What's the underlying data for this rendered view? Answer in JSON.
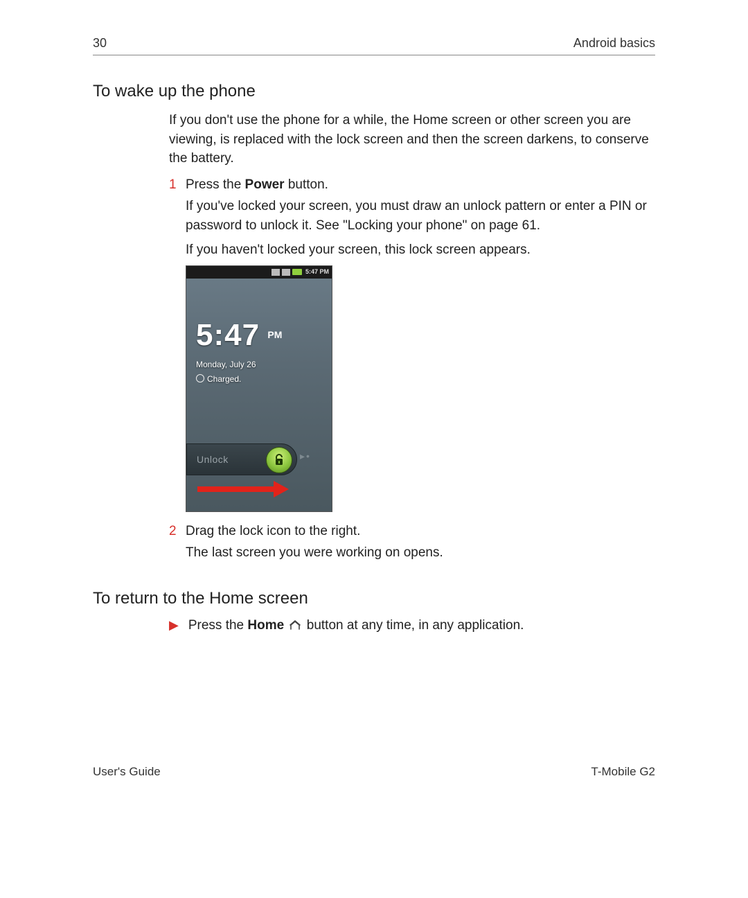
{
  "header": {
    "page_number": "30",
    "chapter": "Android basics"
  },
  "section1": {
    "title": "To wake up the phone",
    "intro": "If you don't use the phone for a while, the Home screen or other screen you are viewing, is replaced with the lock screen and then the screen darkens, to conserve the battery.",
    "steps": [
      {
        "num": "1",
        "line_pre": "Press the ",
        "line_bold": "Power",
        "line_post": " button.",
        "sub1": "If you've locked your screen, you must draw an unlock pattern or enter a PIN or password to unlock it. See \"Locking your phone\" on page 61.",
        "sub2": "If you haven't locked your screen, this lock screen appears."
      },
      {
        "num": "2",
        "line": "Drag the lock icon to the right.",
        "sub1": "The last screen you were working on opens."
      }
    ]
  },
  "phone": {
    "status_time": "5:47 PM",
    "clock_time": "5:47",
    "clock_ampm": "PM",
    "date": "Monday, July 26",
    "charge": "Charged.",
    "slider_label": "Unlock"
  },
  "section2": {
    "title": "To return to the Home screen",
    "line_pre": "Press the ",
    "line_bold": "Home",
    "line_post": " button at any time, in any application."
  },
  "footer": {
    "left": "User's Guide",
    "right": "T-Mobile G2"
  }
}
